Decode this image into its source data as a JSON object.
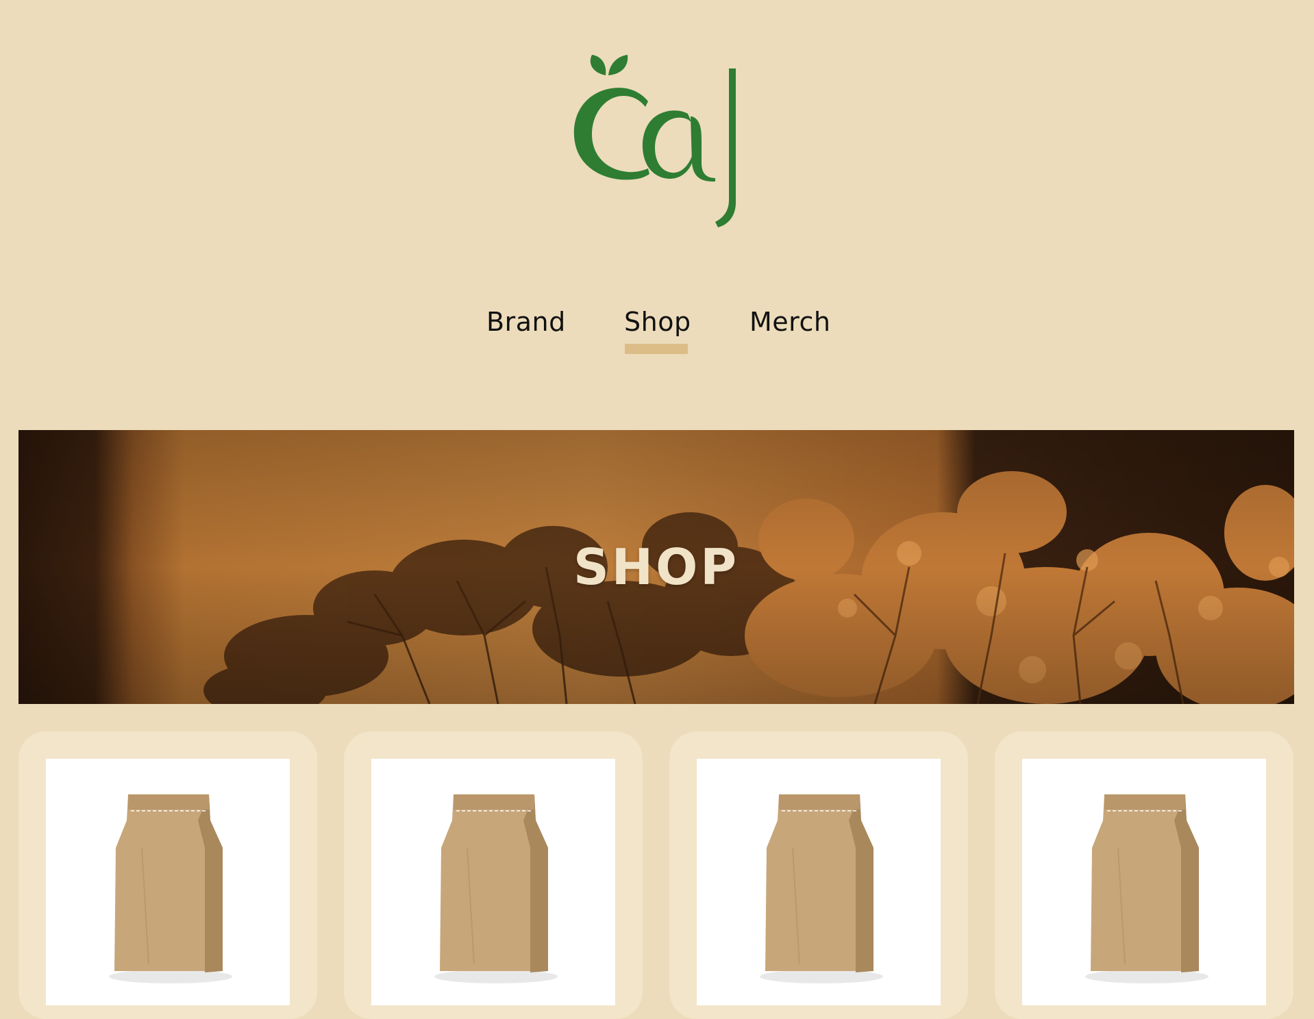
{
  "brand": {
    "logo_text": "čaj",
    "logo_color": "#2e7d32"
  },
  "nav": {
    "items": [
      {
        "label": "Brand",
        "active": false
      },
      {
        "label": "Shop",
        "active": true
      },
      {
        "label": "Merch",
        "active": false
      }
    ],
    "active_underline_color": "#dcbd88"
  },
  "hero": {
    "title": "SHOP"
  },
  "products": [
    {
      "image": "kraft-paper-bag"
    },
    {
      "image": "kraft-paper-bag"
    },
    {
      "image": "kraft-paper-bag"
    },
    {
      "image": "kraft-paper-bag"
    }
  ],
  "colors": {
    "page_background": "#ecdcbb",
    "card_background": "#f2e5ca",
    "hero_text": "#f1e3c8"
  }
}
